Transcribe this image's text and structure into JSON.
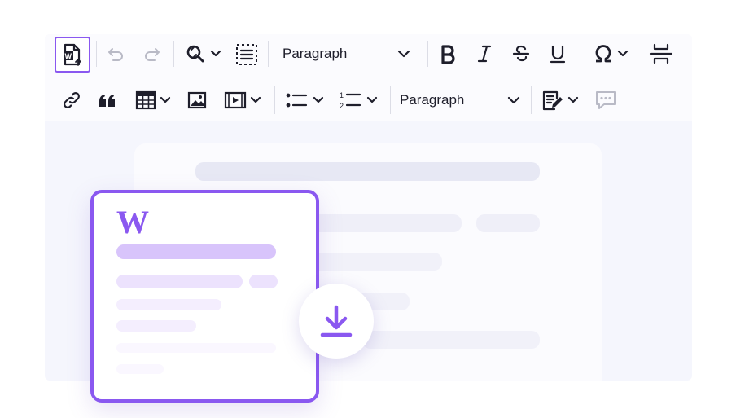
{
  "toolbar": {
    "row1": {
      "import_word_tooltip": "Import from Word",
      "paragraph_dropdown": "Paragraph"
    },
    "row2": {
      "paragraph_dropdown": "Paragraph"
    }
  },
  "illustration": {
    "doc_letter": "W"
  },
  "colors": {
    "accent": "#8a58f0",
    "toolbar_bg": "#fbfbfe",
    "editor_bg": "#f5f6fd",
    "icon": "#1e1e2b",
    "disabled_icon": "#b9bac6"
  }
}
